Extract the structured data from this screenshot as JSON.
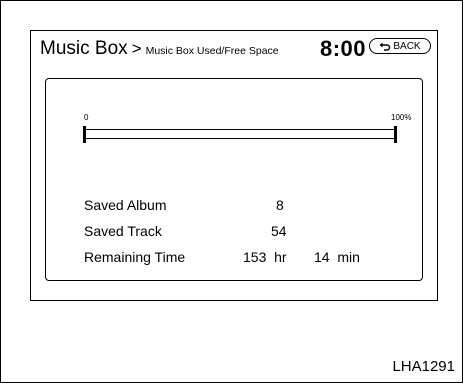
{
  "header": {
    "title": "Music Box",
    "separator": ">",
    "subtitle": "Music Box Used/Free Space",
    "clock": "8:00",
    "back_label": "BACK"
  },
  "usage": {
    "min_label": "0",
    "max_label": "100%",
    "fill_percent": 0
  },
  "stats": {
    "saved_album_label": "Saved Album",
    "saved_album_value": "8",
    "saved_track_label": "Saved Track",
    "saved_track_value": "54",
    "remaining_time_label": "Remaining Time",
    "remaining_hours": "153",
    "hours_unit": "hr",
    "remaining_minutes": "14",
    "minutes_unit": "min"
  },
  "figure_code": "LHA1291",
  "icons": {
    "back": "back-arrow-icon"
  }
}
